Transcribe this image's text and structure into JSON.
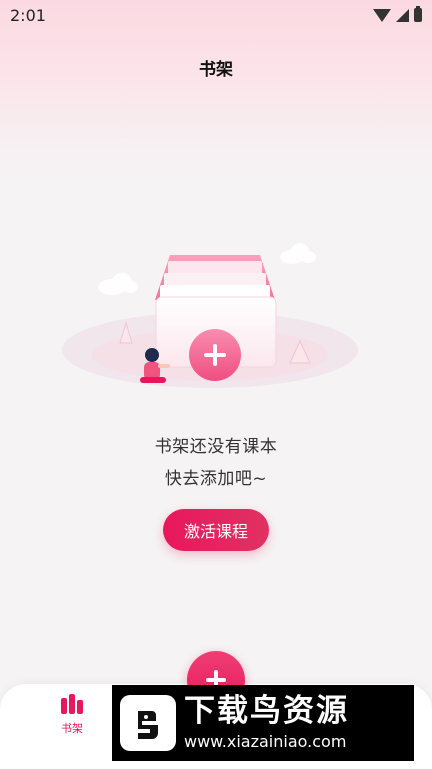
{
  "status_bar": {
    "time": "2:01"
  },
  "header": {
    "title": "书架"
  },
  "empty_state": {
    "line1": "书架还没有课本",
    "line2": "快去添加吧~",
    "button_label": "激活课程"
  },
  "bottom_nav": {
    "tabs": [
      {
        "label": "书架",
        "icon": "bookshelf-icon",
        "active": true
      }
    ],
    "fab_icon": "plus-icon"
  },
  "watermark": {
    "title": "下载鸟资源",
    "url": "www.xiazainiao.com"
  },
  "colors": {
    "accent": "#e8175d",
    "accent_light": "#ef3f74",
    "header_pink": "#fcd9e2",
    "background": "#f5f3f4"
  }
}
